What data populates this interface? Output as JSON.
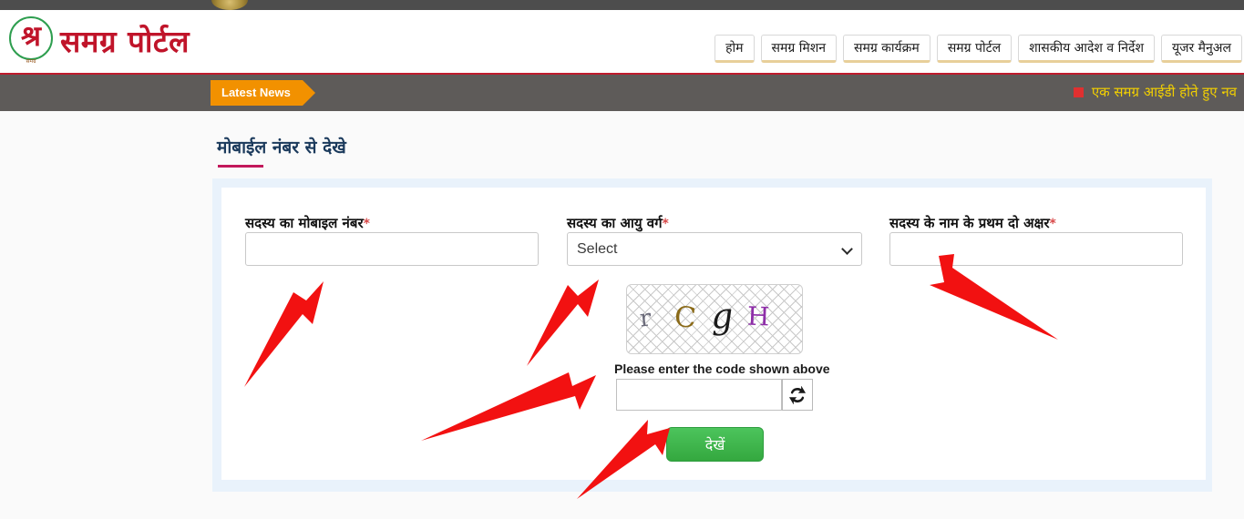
{
  "site": {
    "logo_glyph": "श्र",
    "logo_sub": "समग्र",
    "logo_title": "समग्र पोर्टल"
  },
  "nav": {
    "items": [
      {
        "label": "होम",
        "name": "nav-home"
      },
      {
        "label": "समग्र मिशन",
        "name": "nav-samagra-mission"
      },
      {
        "label": "समग्र कार्यक्रम",
        "name": "nav-samagra-karyakram"
      },
      {
        "label": "समग्र पोर्टल",
        "name": "nav-samagra-portal"
      },
      {
        "label": "शासकीय आदेश व निर्देश",
        "name": "nav-government-orders"
      },
      {
        "label": "यूजर मैनुअल",
        "name": "nav-user-manual"
      }
    ]
  },
  "ticker": {
    "tag_label": "Latest News",
    "item_text": "एक समग्र आईडी होते हुए नव"
  },
  "page": {
    "title": "मोबाईल नंबर से देखे"
  },
  "form": {
    "mobile": {
      "label": "सदस्य का मोबाइल नंबर",
      "required_mark": "*",
      "value": "",
      "placeholder": ""
    },
    "age_group": {
      "label": "सदस्य का आयु वर्ग",
      "required_mark": "*",
      "selected": "Select",
      "options": [
        "Select"
      ]
    },
    "name_initials": {
      "label": "सदस्य के नाम के प्रथम दो अक्षर",
      "required_mark": "*",
      "value": "",
      "placeholder": ""
    },
    "captcha": {
      "characters": [
        "r",
        "C",
        "g",
        "H"
      ],
      "hint": "Please enter the code shown above",
      "value": "",
      "placeholder": "",
      "refresh_icon": "refresh-icon"
    },
    "submit": {
      "label": "देखें"
    }
  },
  "colors": {
    "brand_red": "#c0142a",
    "accent_orange": "#f29100",
    "ticker_bg": "#5e5b59",
    "ticker_text": "#f3d000",
    "title_navy": "#1b3a5c",
    "underline_crimson": "#c2185b",
    "panel_blue": "#e9f2fb",
    "submit_green": "#34a83f",
    "arrow_red": "#f21111"
  },
  "annotations": {
    "arrows": [
      {
        "name": "arrow-to-mobile-input",
        "points_to": "mobile-number-input"
      },
      {
        "name": "arrow-to-age-select",
        "points_to": "age-group-select"
      },
      {
        "name": "arrow-to-name-input",
        "points_to": "name-initials-input"
      },
      {
        "name": "arrow-to-captcha-input",
        "points_to": "captcha-input"
      },
      {
        "name": "arrow-to-submit-button",
        "points_to": "submit-button"
      }
    ]
  }
}
